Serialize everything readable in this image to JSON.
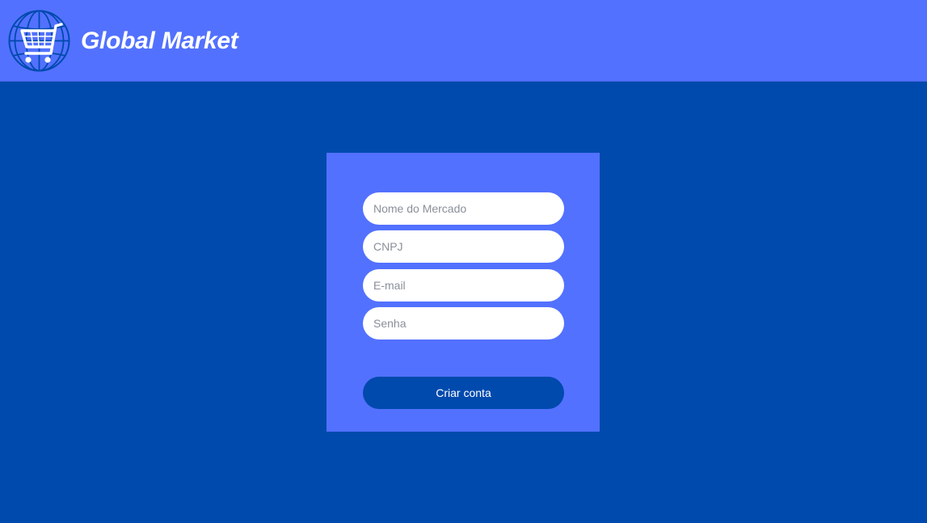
{
  "header": {
    "brand_name": "Global Market",
    "logo_icon": "globe-cart-icon"
  },
  "form": {
    "fields": [
      {
        "placeholder": "Nome do Mercado",
        "value": ""
      },
      {
        "placeholder": "CNPJ",
        "value": ""
      },
      {
        "placeholder": "E-mail",
        "value": ""
      },
      {
        "placeholder": "Senha",
        "value": ""
      }
    ],
    "submit_label": "Criar conta"
  },
  "colors": {
    "page_background": "#004AAD",
    "header_background": "#5271FF",
    "card_background": "#5271FF",
    "button_background": "#004AAD",
    "text_light": "#FFFFFF"
  }
}
